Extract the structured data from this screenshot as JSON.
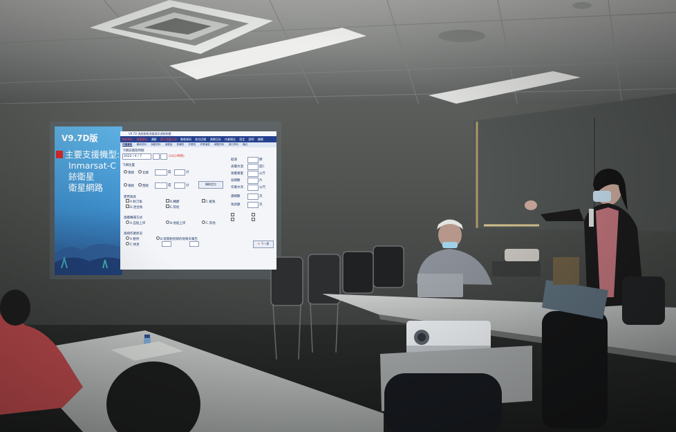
{
  "slide": {
    "version_label": "V9.7D版",
    "items": [
      "主要支援機型:",
      "Inmarsat-C",
      "銥衛星",
      "衛星網路"
    ]
  },
  "app": {
    "title": "V9.7D 漁船動態漁獲資訊通報軟體",
    "menu": [
      "漁船資料",
      "漁獲資料",
      "通報",
      "電子漁獲日誌",
      "動態資料",
      "船位回報",
      "漁撈日誌",
      "作業報告",
      "設定",
      "說明",
      "離開"
    ],
    "tabs": [
      "作業資料",
      "補填資料",
      "漁獲資料",
      "漁獲量",
      "魚種別",
      "作業別",
      "作業漁區",
      "轉載資料",
      "港口資料",
      "備註"
    ],
    "date_label": "下網日期及時間",
    "date_value": "2022 / 4 / 7",
    "date_hint": "(24小時制)",
    "position_label": "下網位置",
    "lat_options": [
      "南緯",
      "北緯"
    ],
    "lon_options": [
      "東經",
      "西經"
    ],
    "deg_unit": "度",
    "min_unit": "分",
    "get_position_button": "擷取定位",
    "method_label": "使用漁具",
    "methods": [
      "A.秋刀魚",
      "B.鯖鰺",
      "C.魷魚",
      "D.混合魚",
      "E.其他"
    ],
    "fish_method_label": "漁獲轉運方式",
    "fish_methods": [
      "A.自船上岸",
      "B.他船上岸",
      "C.其他"
    ],
    "rest_label": "漁撈作業狀況",
    "rest_options": [
      "A.暫停",
      "B.從開始到目的地每天報告",
      "C.休息"
    ],
    "right_fields": [
      "船速",
      "表層水溫",
      "漁獲重量",
      "投網數",
      "作業水深",
      "揚網數",
      "漁具數"
    ],
    "right_units": [
      "節",
      "度C",
      "公斤",
      "片",
      "公尺",
      "次",
      "次"
    ],
    "next_button": "下一頁"
  }
}
